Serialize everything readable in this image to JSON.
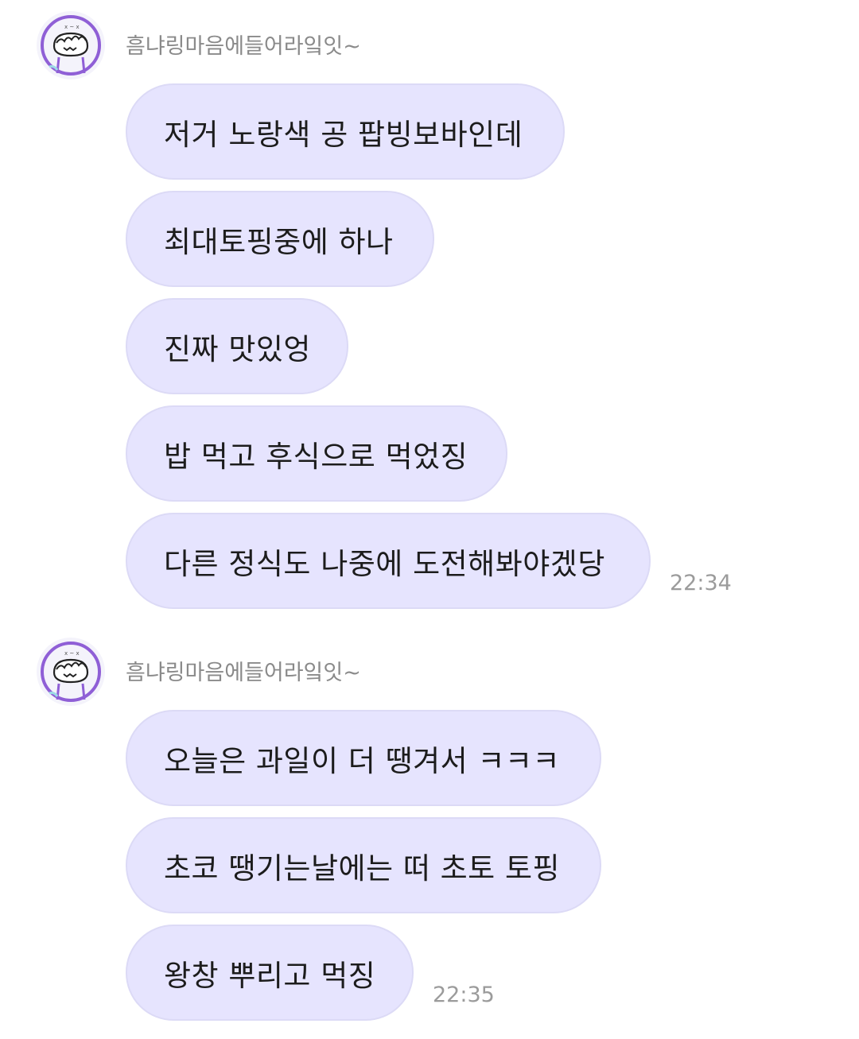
{
  "chat": {
    "groups": [
      {
        "sender": "흠냐링마음에들어라잌잇~",
        "avatar_icon": "cartoon-face-icon",
        "messages": [
          "저거 노랑색 공 팝빙보바인데",
          "최대토핑중에 하나",
          "진짜 맛있엉",
          "밥 먹고 후식으로 먹었징",
          "다른 정식도 나중에 도전해봐야겠당"
        ],
        "time": "22:34"
      },
      {
        "sender": "흠냐링마음에들어라잌잇~",
        "avatar_icon": "cartoon-face-icon",
        "messages": [
          "오늘은 과일이 더 땡겨서 ㅋㅋㅋ",
          "초코 땡기는날에는 떠 초토 토핑",
          "왕창 뿌리고 먹징"
        ],
        "time": "22:35"
      }
    ]
  },
  "colors": {
    "bubble_bg": "#e6e4fe",
    "bubble_border": "#dcdaf6",
    "sender_text": "#8a8a8a",
    "time_text": "#9b9b9b",
    "avatar_accent": "#8f5fd6"
  }
}
